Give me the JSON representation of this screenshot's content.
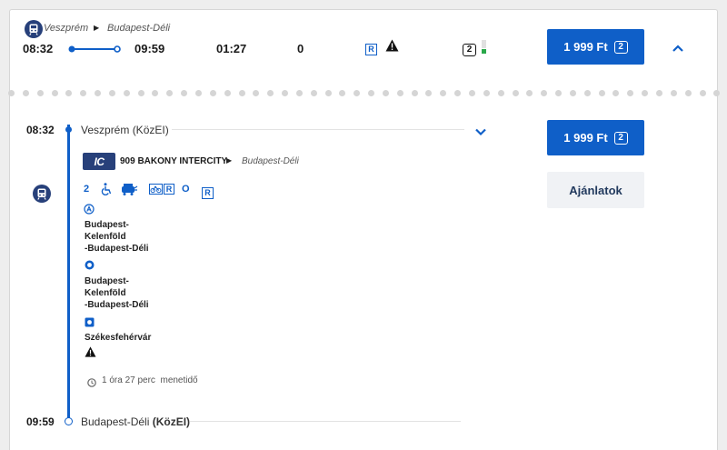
{
  "summary": {
    "from": "Veszprém",
    "to": "Budapest-Déli",
    "dep_time": "08:32",
    "arr_time": "09:59",
    "duration": "01:27",
    "transfers": "0",
    "reservation_badge": "R",
    "class_badge": "2",
    "price": "1 999 Ft",
    "price_class": "2"
  },
  "detail": {
    "dep_time": "08:32",
    "dep_station": "Veszprém (KözEI)",
    "train_logo": "IC",
    "train_name": "909 BAKONY INTERCITY",
    "train_direction": "Budapest-Déli",
    "class_label": "2",
    "service_o": "O",
    "service_r": "R",
    "service_bike_r": "R",
    "stops": [
      {
        "name": "Budapest-\nKelenföld\n-Budapest-Déli"
      },
      {
        "name": "Budapest-\nKelenföld\n-Budapest-Déli"
      },
      {
        "name": "Székesfehérvár"
      }
    ],
    "travel_time": "1 óra 27 perc  menetidő",
    "arr_time": "09:59",
    "arr_station_plain": "Budapest-Déli ",
    "arr_station_bold": "(KözEI)",
    "price": "1 999 Ft",
    "price_class": "2",
    "offers_label": "Ajánlatok"
  },
  "colors": {
    "brand_blue": "#0f5fc8",
    "dark_navy": "#27407a",
    "green_occupancy": "#2aa84a"
  },
  "icons": [
    "train-icon",
    "play-arrow-icon",
    "warning-icon",
    "chevron-up-icon",
    "chevron-down-icon",
    "wheelchair-icon",
    "bicycle-icon",
    "clock-icon"
  ]
}
